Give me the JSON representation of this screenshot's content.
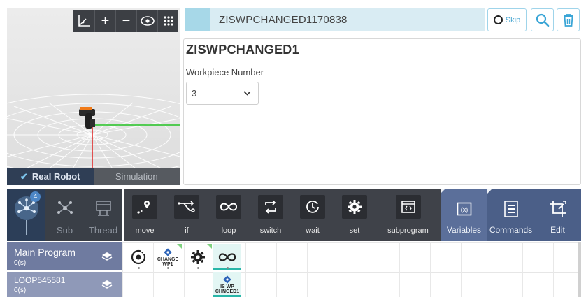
{
  "viewport": {
    "toolbar_icons": [
      "axes-icon",
      "zoom-in-icon",
      "zoom-out-icon",
      "eye-icon",
      "grid-menu-icon"
    ],
    "mode_tabs": {
      "real": "Real Robot",
      "simulation": "Simulation"
    }
  },
  "header": {
    "name_field_value": "ZISWPCHANGED1170838",
    "skip_label": "Skip"
  },
  "properties": {
    "command_title": "ZISWPCHANGED1",
    "workpiece_label": "Workpiece Number",
    "workpiece_value": "3"
  },
  "program_type_tabs": [
    {
      "label": "",
      "badge": "4"
    },
    {
      "label": "Sub"
    },
    {
      "label": "Thread"
    }
  ],
  "command_toolbar": [
    {
      "label": "move",
      "icon": "move-pin-icon"
    },
    {
      "label": "if",
      "icon": "branch-icon"
    },
    {
      "label": "loop",
      "icon": "loop-icon"
    },
    {
      "label": "switch",
      "icon": "switch-icon"
    },
    {
      "label": "wait",
      "icon": "clock-icon"
    },
    {
      "label": "set",
      "icon": "gear-icon"
    },
    {
      "label": "subprogram",
      "icon": "subprogram-icon"
    }
  ],
  "side_toolbar": [
    {
      "label": "Variables",
      "icon": "variables-icon"
    },
    {
      "label": "Commands",
      "icon": "commands-list-icon"
    },
    {
      "label": "Edit",
      "icon": "crop-edit-icon"
    }
  ],
  "programs": [
    {
      "name": "Main Program",
      "time": "0(s)"
    },
    {
      "name": "LOOP545581",
      "time": "0(s)"
    }
  ],
  "grid_cells": {
    "change_wp_tag": "CHANGE\nWP1",
    "is_wp_tag": "IS WP\nCHNGED1"
  },
  "colors": {
    "accent_teal": "#28b6a8",
    "toolbar_dark": "#3f4249",
    "side_blue": "#4b5f88",
    "name_bar": "#d9ecf3"
  }
}
